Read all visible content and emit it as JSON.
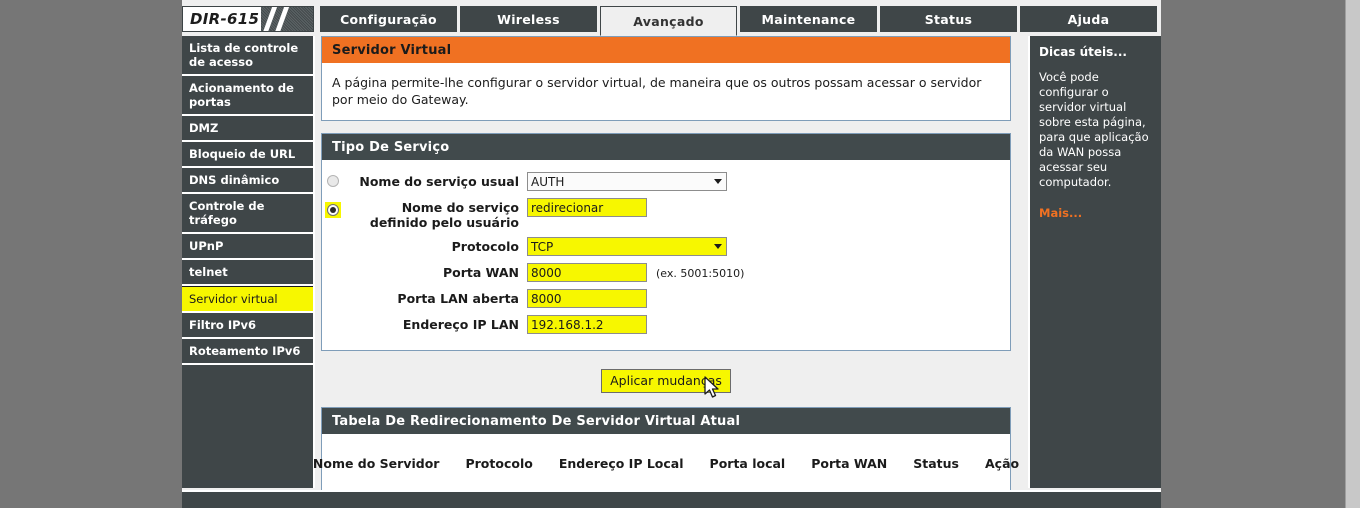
{
  "window": {
    "logo": "DIR-615"
  },
  "tabs": [
    {
      "label": "Configuração",
      "active": false
    },
    {
      "label": "Wireless",
      "active": false
    },
    {
      "label": "Avançado",
      "active": true
    },
    {
      "label": "Maintenance",
      "active": false
    },
    {
      "label": "Status",
      "active": false
    },
    {
      "label": "Ajuda",
      "active": false
    }
  ],
  "sidebar": {
    "items": [
      {
        "label": "Lista de controle de acesso",
        "selected": false
      },
      {
        "label": "Acionamento de portas",
        "selected": false
      },
      {
        "label": "DMZ",
        "selected": false
      },
      {
        "label": "Bloqueio de URL",
        "selected": false
      },
      {
        "label": "DNS dinâmico",
        "selected": false
      },
      {
        "label": "Controle de tráfego",
        "selected": false
      },
      {
        "label": "UPnP",
        "selected": false
      },
      {
        "label": "telnet",
        "selected": false
      },
      {
        "label": "Servidor virtual",
        "selected": true
      },
      {
        "label": "Filtro IPv6",
        "selected": false
      },
      {
        "label": "Roteamento IPv6",
        "selected": false
      }
    ]
  },
  "intro": {
    "title": "Servidor Virtual",
    "description": "A página permite-lhe configurar o servidor virtual, de maneira que os outros possam acessar o servidor por meio do Gateway."
  },
  "service_type": {
    "title": "Tipo De Serviço",
    "usual_label": "Nome do serviço usual",
    "usual_selected": false,
    "usual_value": "AUTH",
    "custom_label": "Nome do serviço definido pelo usuário",
    "custom_selected": true,
    "custom_value": "redirecionar",
    "protocol_label": "Protocolo",
    "protocol_value": "TCP",
    "wan_port_label": "Porta WAN",
    "wan_port_value": "8000",
    "wan_port_hint": "(ex. 5001:5010)",
    "lan_port_label": "Porta LAN aberta",
    "lan_port_value": "8000",
    "lan_ip_label": "Endereço IP LAN",
    "lan_ip_value": "192.168.1.2"
  },
  "apply": {
    "label": "Aplicar mudanças"
  },
  "table": {
    "title": "Tabela De Redirecionamento De Servidor Virtual Atual",
    "columns": [
      "Nome do Servidor",
      "Protocolo",
      "Endereço IP Local",
      "Porta local",
      "Porta WAN",
      "Status",
      "Ação"
    ],
    "rows": []
  },
  "help": {
    "title": "Dicas úteis...",
    "text": "Você pode configurar o servidor virtual sobre esta página, para que aplicação da WAN possa acessar seu computador.",
    "more": "Mais..."
  },
  "colors": {
    "accent_orange": "#f07122",
    "panel_dark": "#414a4c",
    "chrome_dark": "#3f4648",
    "highlight_yellow": "#f7f700",
    "desktop_gray": "#767676"
  }
}
